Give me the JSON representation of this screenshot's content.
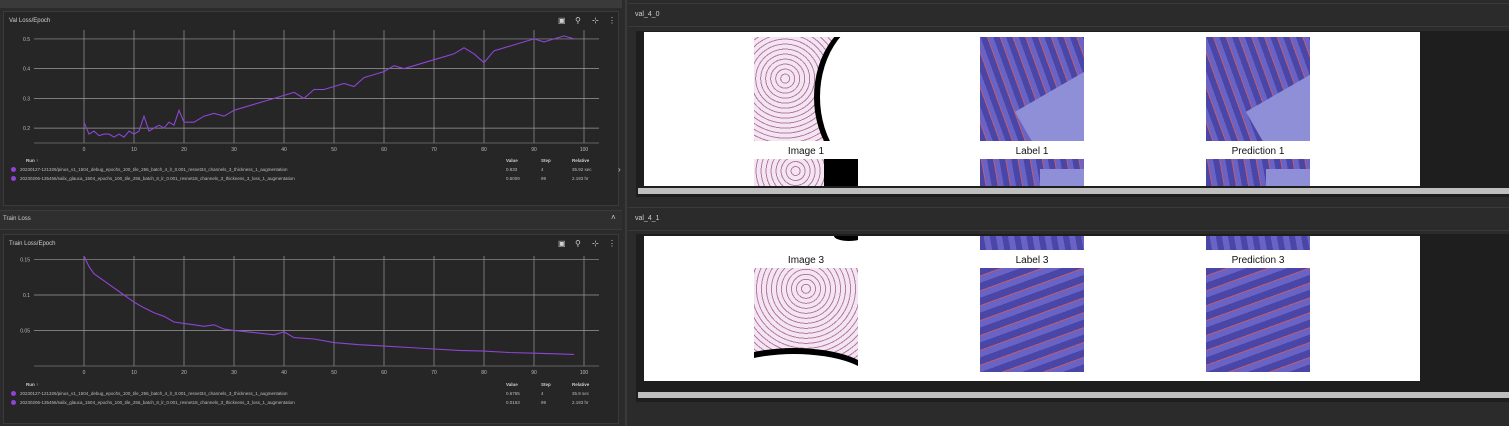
{
  "val_loss_section": {
    "title": "Val Loss/Epoch",
    "table": {
      "headers": [
        "Run ↑",
        "Value",
        "Step",
        "Relative"
      ],
      "rows": [
        {
          "run": "20230127-121326/pinus_v1_1504_debug_epochs_100_tile_256_batch_4_lr_0.001_resnet34_channels_3_thickness_1_augmentation",
          "value": "0.833",
          "step": "4",
          "relative": "35.92 sec"
        },
        {
          "run": "20230206-135456/salix_glauca_1504_epochs_100_tile_256_batch_8_lr_0.001_resnet18_channels_3_thickness_3_loss_1_augmentation",
          "value": "0.5009",
          "step": "99",
          "relative": "2.193 hr"
        }
      ]
    }
  },
  "train_loss_section": {
    "header": "Train Loss",
    "title": "Train Loss/Epoch",
    "table": {
      "headers": [
        "Run ↑",
        "Value",
        "Step",
        "Relative"
      ],
      "rows": [
        {
          "run": "20230127-121326/pinus_v1_1504_debug_epochs_100_tile_256_batch_4_lr_0.001_resnet34_channels_3_thickness_1_augmentation",
          "value": "0.6755",
          "step": "4",
          "relative": "35.9 sec"
        },
        {
          "run": "20230206-135456/salix_glauca_1504_epochs_100_tile_256_batch_8_lr_0.001_resnet18_channels_3_thickness_3_loss_1_augmentation",
          "value": "0.0163",
          "step": "99",
          "relative": "2.193 hr"
        }
      ]
    }
  },
  "image_panels": {
    "val_4_0": {
      "label": "val_4_0",
      "captions_top": [
        "Image 1",
        "Label 1",
        "Prediction 1"
      ]
    },
    "val_4_1": {
      "label": "val_4_1",
      "captions": [
        "Image 3",
        "Label 3",
        "Prediction 3"
      ]
    }
  },
  "icons": {
    "image": "image-icon",
    "pin": "pin-icon",
    "fit": "fit-domain-icon",
    "more": "more-vert-icon",
    "collapse": "chevron-up-icon"
  },
  "colors": {
    "series": "#8e44d6",
    "background": "#262626",
    "grid": "#cfcfcf"
  },
  "chart_data": [
    {
      "type": "line",
      "title": "Val Loss/Epoch",
      "xlim": [
        -10,
        103
      ],
      "ylim": [
        0.15,
        0.53
      ],
      "xticks": [
        0,
        10,
        20,
        30,
        40,
        50,
        60,
        70,
        80,
        90,
        100
      ],
      "yticks": [
        0.2,
        0.3,
        0.4,
        0.5
      ],
      "xtick_labels": [
        "0",
        "10",
        "20",
        "30",
        "40",
        "50",
        "60",
        "70",
        "80",
        "90",
        "100"
      ],
      "ytick_labels": [
        "0.2",
        "0.3",
        "0.4",
        "0.5"
      ],
      "series": [
        {
          "x": [
            0,
            1,
            2,
            3,
            4,
            5,
            6,
            7,
            8,
            9,
            10,
            11,
            12,
            13,
            14,
            15,
            16,
            17,
            18,
            19,
            20,
            22,
            24,
            26,
            28,
            30,
            32,
            34,
            36,
            38,
            40,
            42,
            44,
            46,
            48,
            50,
            52,
            54,
            56,
            58,
            60,
            62,
            64,
            66,
            68,
            70,
            72,
            74,
            76,
            78,
            80,
            82,
            84,
            86,
            88,
            90,
            92,
            94,
            96,
            98
          ],
          "y": [
            0.22,
            0.18,
            0.19,
            0.175,
            0.18,
            0.18,
            0.17,
            0.18,
            0.17,
            0.19,
            0.18,
            0.19,
            0.24,
            0.19,
            0.2,
            0.21,
            0.2,
            0.22,
            0.21,
            0.26,
            0.22,
            0.22,
            0.24,
            0.25,
            0.24,
            0.26,
            0.27,
            0.28,
            0.29,
            0.3,
            0.31,
            0.32,
            0.3,
            0.33,
            0.33,
            0.34,
            0.35,
            0.34,
            0.37,
            0.38,
            0.39,
            0.41,
            0.4,
            0.41,
            0.42,
            0.43,
            0.44,
            0.45,
            0.47,
            0.45,
            0.42,
            0.46,
            0.47,
            0.48,
            0.49,
            0.5,
            0.49,
            0.5,
            0.51,
            0.5
          ]
        }
      ]
    },
    {
      "type": "line",
      "title": "Train Loss/Epoch",
      "xlim": [
        -10,
        103
      ],
      "ylim": [
        0.0,
        0.155
      ],
      "xticks": [
        0,
        10,
        20,
        30,
        40,
        50,
        60,
        70,
        80,
        90,
        100
      ],
      "yticks": [
        0.05,
        0.1,
        0.15
      ],
      "xtick_labels": [
        "0",
        "10",
        "20",
        "30",
        "40",
        "50",
        "60",
        "70",
        "80",
        "90",
        "100"
      ],
      "ytick_labels": [
        "0.05",
        "0.1",
        "0.15"
      ],
      "series": [
        {
          "x": [
            0,
            1,
            2,
            3,
            4,
            6,
            8,
            10,
            12,
            14,
            16,
            18,
            20,
            22,
            24,
            26,
            28,
            30,
            34,
            38,
            40,
            42,
            46,
            50,
            55,
            60,
            65,
            70,
            75,
            80,
            85,
            90,
            95,
            98
          ],
          "y": [
            0.155,
            0.14,
            0.13,
            0.125,
            0.12,
            0.11,
            0.1,
            0.09,
            0.082,
            0.075,
            0.07,
            0.062,
            0.06,
            0.058,
            0.056,
            0.058,
            0.052,
            0.05,
            0.047,
            0.044,
            0.048,
            0.04,
            0.038,
            0.033,
            0.03,
            0.028,
            0.026,
            0.024,
            0.022,
            0.021,
            0.019,
            0.018,
            0.017,
            0.0163
          ]
        }
      ]
    }
  ]
}
